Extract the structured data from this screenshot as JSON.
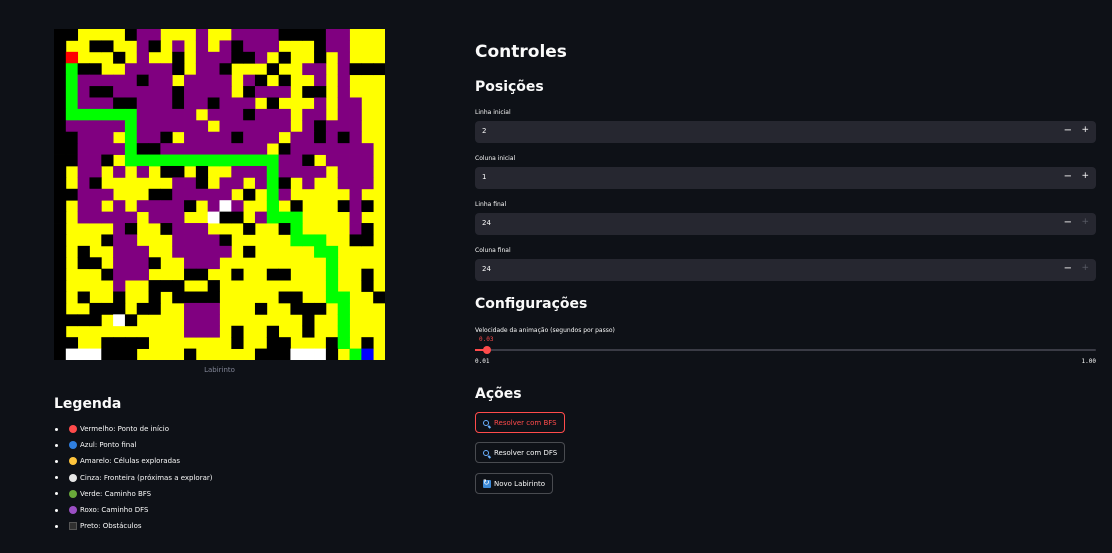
{
  "maze": {
    "grid": [
      "..YYYYKPPYYYPYYPPPPKKKKPPYYY",
      ".YYKKYYPKYPYPYPKPPPYYYKPPYYY",
      ".RYYYKYPYYKYPPPKKPYKYYKYPYYY",
      ".GKKYYPPPPKYPPKYYYKYYPPYPKKK",
      ".GPPPPPKPPYPPPPYPKYKYYPYPYYY",
      ".GPKKPPPPPKPPPPYKPPPYKKYPYYY",
      ".GPPPKKPPPKPPKPPPYKYYYPYPPYY",
      ".GGGGGGPPPPPYPPPKPPPYPPYPPYY",
      ".PPPPPGPPPPPPYPPPPPPYPKPPPYY",
      ".KPPPYGPPKYPPPPKPPPYPPKPKPYY",
      ".KPPPPGKKPPPPPPPPPYKPPPPPPPY",
      ".KPPKYGGGGGGGGGGGGGPPKYPPPPY",
      ".YPPYPYPYKKYKYYPPPGPPPPYPPPY",
      ".YPKYYYYYYPPKYPPYPGKYPYYPPPY",
      ".KPPPYYYKKPPPPPYKYGPYYYYYPYY",
      ".YPPYPYPPPPKYPWPYYGYKYYYKPKY",
      ".YPPPPPYPPPYYWKKYPGGGYYYYPYY",
      ".YYYYPKYYKPPPYYYKYYKGYYYYPKY",
      ".YYYKPPYYYPPPPKYYYYYGGGYYKKY",
      ".YKYYPPPYYPPPPPYKYYYYYGGYYYY",
      ".YKKYPPPKYYPPPYYYYYYYYYGYYYY",
      ".YYYKPPPYYYKKYYKYYKKYYYGYYKY",
      ".YYYYPYYKKKYYKYYYYYYYYYGYYKY",
      ".YKYYKYYKYKKKKYYYYYKKYYGGYYK",
      ".YYKKKYKKYYPPPYYYKYYKKKYGYYY",
      ".KKKYWKYYYYPPPYYYYYYYKYYGYYY",
      ".YYYYYYYYYYPPPYKYYKYYKYYGYYY",
      ".KYYKKKKYYYYYYYKYYKKYYYKGYKY",
      ".WWWKKKYYYYKYYYYYKKKWWWKYGBY"
    ],
    "colors": {
      "Y": "#ffff00",
      "K": "#000000",
      "P": "#800080",
      "G": "#00ff00",
      "R": "#ff0000",
      "B": "#0000ff",
      "W": "#ffffff",
      ".": "#000000"
    },
    "caption": "Labirinto"
  },
  "legend": {
    "title": "Legenda",
    "items": [
      {
        "color": "#ff4b4b",
        "shape": "circle",
        "text": "Vermelho: Ponto de início"
      },
      {
        "color": "#2f7fe0",
        "shape": "circle",
        "text": "Azul: Ponto final"
      },
      {
        "color": "#ffc53d",
        "shape": "circle",
        "text": "Amarelo: Células exploradas"
      },
      {
        "color": "#e6e6e6",
        "shape": "circle",
        "text": "Cinza: Fronteira (próximas a explorar)"
      },
      {
        "color": "#6aaa3a",
        "shape": "circle",
        "text": "Verde: Caminho BFS"
      },
      {
        "color": "#9b4fc4",
        "shape": "circle",
        "text": "Roxo: Caminho DFS"
      },
      {
        "color": "#303030",
        "shape": "square",
        "text": "Preto: Obstáculos"
      }
    ]
  },
  "controls": {
    "title": "Controles",
    "positions_header": "Posições",
    "fields": [
      {
        "label": "Linha inicial",
        "value": "2",
        "minus": "−",
        "plus": "+"
      },
      {
        "label": "Coluna inicial",
        "value": "1",
        "minus": "−",
        "plus": "+"
      },
      {
        "label": "Linha final",
        "value": "24",
        "minus": "−",
        "plus": "+"
      },
      {
        "label": "Coluna final",
        "value": "24",
        "minus": "−",
        "plus": "+"
      }
    ],
    "config_header": "Configurações",
    "slider": {
      "label": "Velocidade da animação (segundos por passo)",
      "value": "0.03",
      "min": "0.01",
      "max": "1.00",
      "fraction": 0.02
    },
    "actions_header": "Ações",
    "buttons": [
      {
        "label": "Resolver com BFS",
        "icon": "search-icon"
      },
      {
        "label": "Resolver com DFS",
        "icon": "search-icon"
      },
      {
        "label": "Novo Labirinto",
        "icon": "refresh-icon"
      }
    ]
  }
}
